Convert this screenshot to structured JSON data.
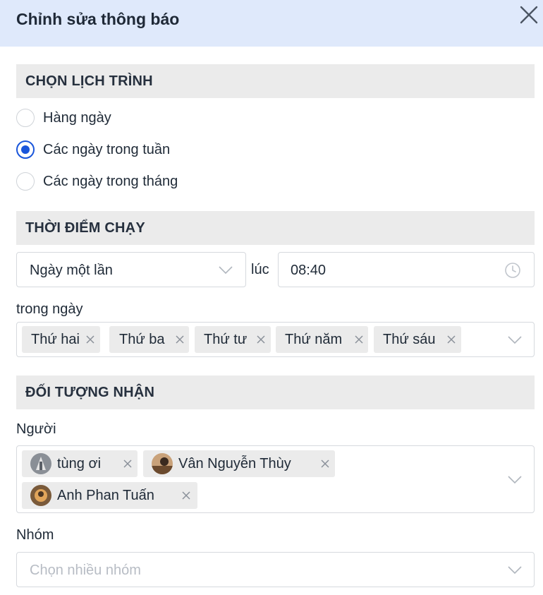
{
  "dialog": {
    "title": "Chỉnh sửa thông báo",
    "close_icon": "close-icon"
  },
  "schedule": {
    "heading": "CHỌN LỊCH TRÌNH",
    "options": [
      {
        "label": "Hàng ngày",
        "selected": false
      },
      {
        "label": "Các ngày trong tuần",
        "selected": true
      },
      {
        "label": "Các ngày trong tháng",
        "selected": false
      }
    ]
  },
  "run_time": {
    "heading": "THỜI ĐIỂM CHẠY",
    "frequency_value": "Ngày một lần",
    "at_label": "lúc",
    "time_value": "08:40",
    "time_icon": "clock-icon",
    "days_label": "trong ngày",
    "days": [
      "Thứ hai",
      "Thứ ba",
      "Thứ tư",
      "Thứ năm",
      "Thứ sáu"
    ]
  },
  "recipients": {
    "heading": "ĐỐI TƯỢNG NHẬN",
    "people_label": "Người",
    "people": [
      {
        "name": "tùng ơi"
      },
      {
        "name": "Vân Nguyễn Thùy"
      },
      {
        "name": "Anh Phan Tuấn"
      }
    ],
    "group_label": "Nhóm",
    "group_placeholder": "Chọn nhiều nhóm"
  },
  "colors": {
    "header_bg": "#dfe9fb",
    "accent": "#1a56db",
    "section_bg": "#ebebeb",
    "tag_bg": "#ebebeb"
  }
}
